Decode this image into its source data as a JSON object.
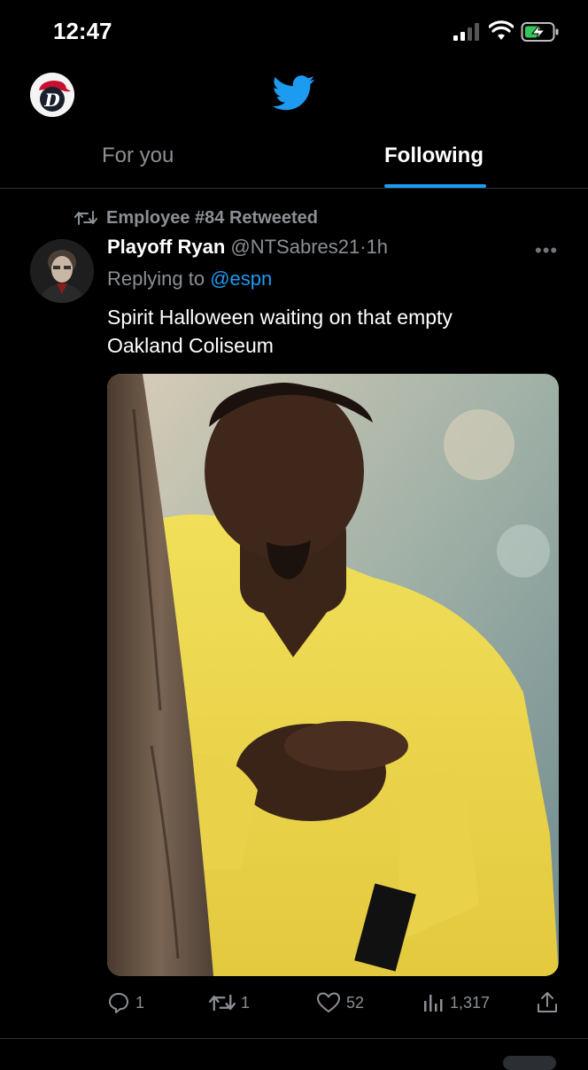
{
  "status": {
    "time": "12:47"
  },
  "header": {
    "logo": "twitter-bird-icon",
    "tabs": [
      {
        "label": "For you",
        "active": false
      },
      {
        "label": "Following",
        "active": true
      }
    ]
  },
  "tweet": {
    "retweeted_by": "Employee #84 Retweeted",
    "author_name": "Playoff Ryan",
    "author_handle": "@NTSabres21",
    "separator": "·",
    "time_ago": "1h",
    "replying_prefix": "Replying to",
    "replying_to": "@espn",
    "text": "Spirit Halloween waiting on that empty Oakland Coliseum",
    "actions": {
      "replies": "1",
      "retweets": "1",
      "likes": "52",
      "views": "1,317"
    }
  },
  "colors": {
    "accent": "#1d9bf0",
    "background": "#000000",
    "muted": "#8b9095"
  }
}
